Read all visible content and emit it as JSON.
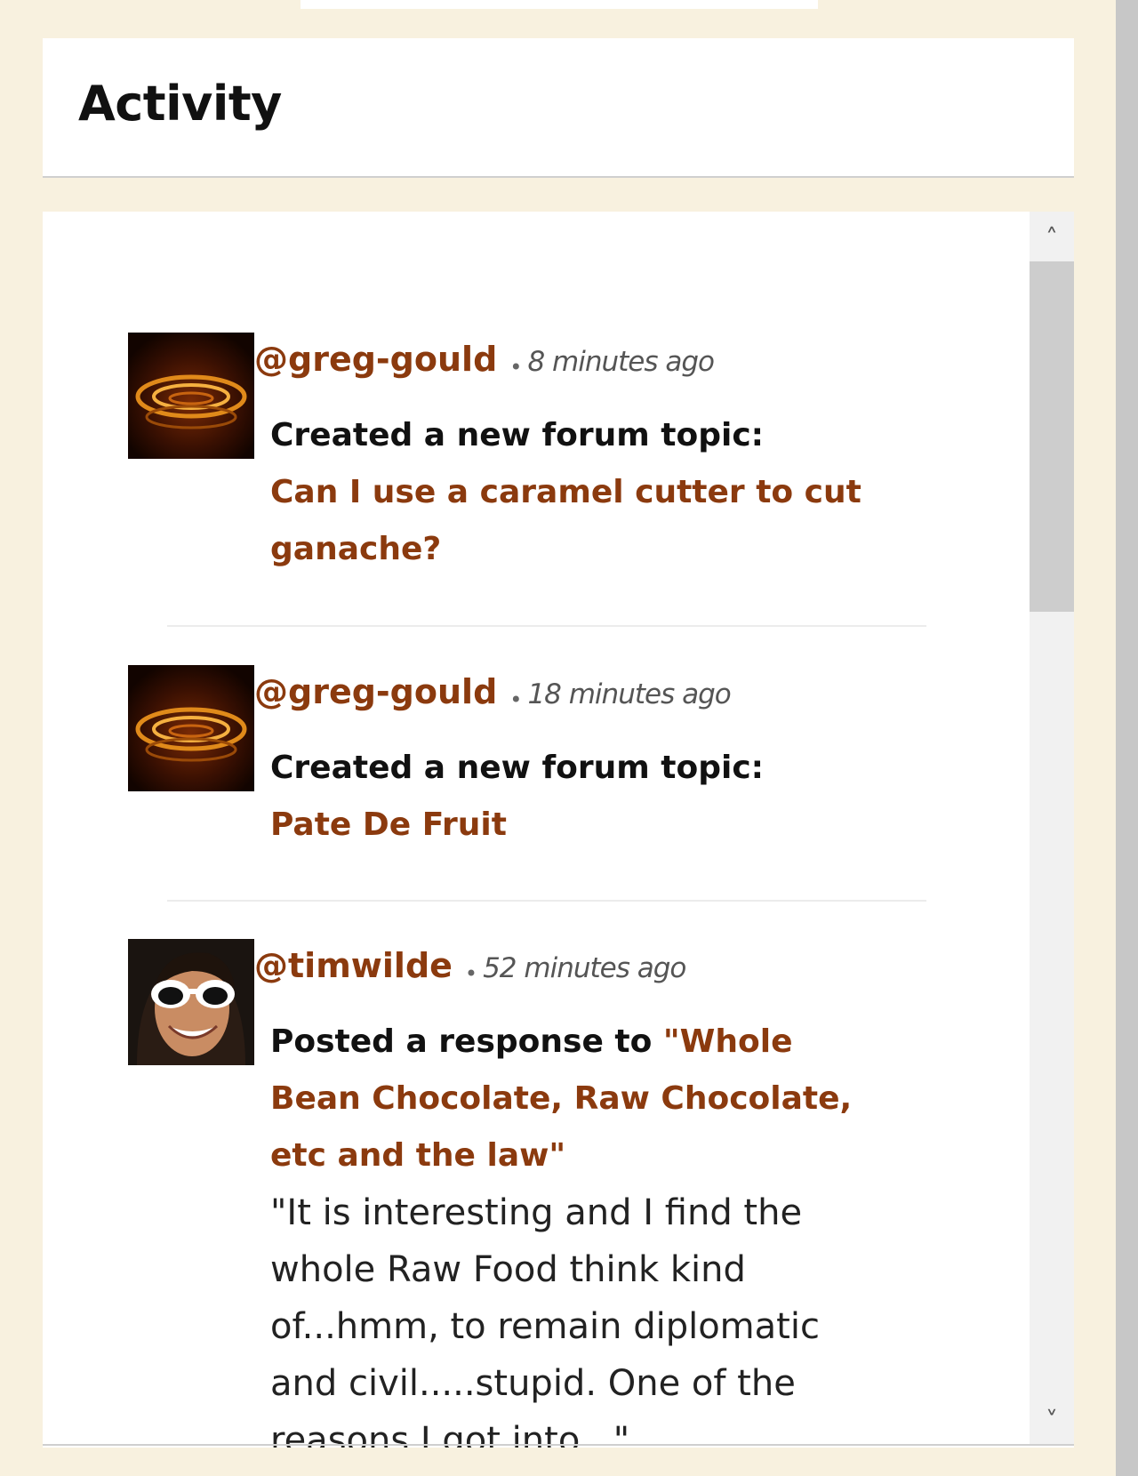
{
  "header": {
    "title": "Activity"
  },
  "scrollbar": {
    "up_glyph": "˄",
    "down_glyph": "˅"
  },
  "feed": {
    "items": [
      {
        "avatar": "orange-ripple-avatar",
        "username": "@greg-gould",
        "separator": "•",
        "time": "8 minutes ago",
        "action": "Created a new forum topic:",
        "topic": "Can I use a caramel cutter to cut ganache?"
      },
      {
        "avatar": "orange-ripple-avatar",
        "username": "@greg-gould",
        "separator": "•",
        "time": "18 minutes ago",
        "action": "Created a new forum topic:",
        "topic": "Pate De Fruit"
      },
      {
        "avatar": "sunglasses-portrait-avatar",
        "username": "@timwilde",
        "separator": "•",
        "time": "52 minutes ago",
        "action": "Posted a response to",
        "topic": "\"Whole Bean Chocolate, Raw Chocolate, etc and the law\"",
        "excerpt": "\"It is interesting and I find the whole Raw Food think kind of...hmm, to remain diplomatic and civil.....stupid.   One of the reasons I got into...\""
      }
    ]
  },
  "colors": {
    "page_background": "#f8f1df",
    "link": "#8b3a0e",
    "panel": "#ffffff"
  }
}
